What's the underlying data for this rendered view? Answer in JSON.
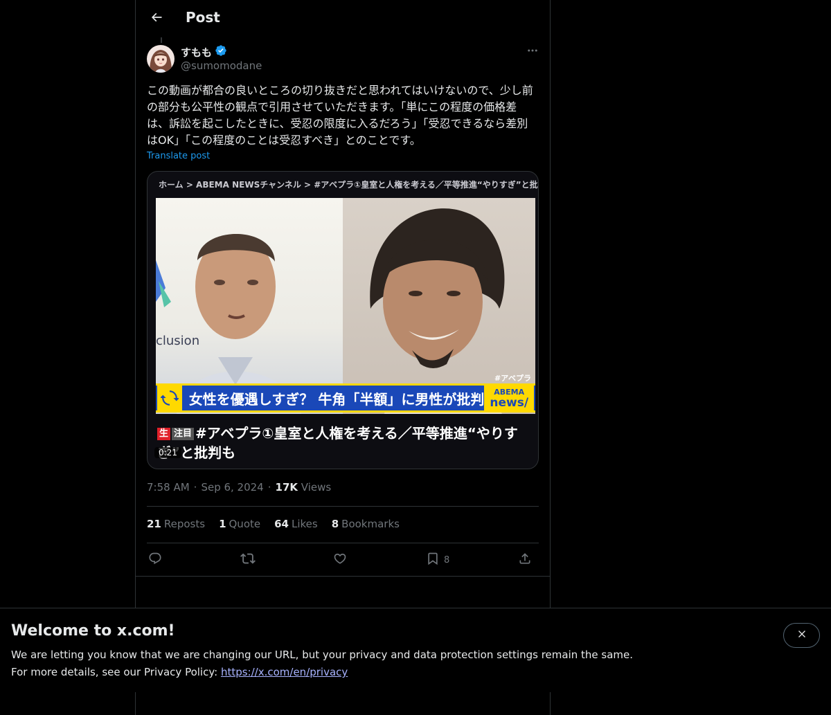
{
  "header": {
    "title": "Post",
    "back_icon": "arrow-left-icon"
  },
  "post": {
    "author": {
      "name": "すもも",
      "handle": "@sumomodane",
      "verified": true,
      "verified_color": "#1d9bf0"
    },
    "text": "この動画が都合の良いところの切り抜きだと思われてはいけないので、少し前の部分も公平性の観点で引用させていただきます。「単にこの程度の価格差は、訴訟を起こしたときに、受忍の限度に入るだろう」「受忍できるなら差別はOK」「この程度のことは受忍すべき」とのことです。",
    "translate_label": "Translate post",
    "media": {
      "breadcrumb": "ホーム > ABEMA NEWSチャンネル > #アベプラ①皇室と人権を考える／平等推進“やりすぎ”と批判も",
      "left_sign_text": "clusion",
      "overlay_hashtag": "#アベプラ",
      "ticker_text": "女性を優遇しすぎ？ 牛角「半額」に男性が批判",
      "brand_line1": "ABEMA",
      "brand_line2": "news/",
      "caption_tag_live": "生",
      "caption_tag_hot": "注目",
      "caption": "#アベプラ①皇室と人権を考える／平等推進“やりすぎ”と批判も",
      "duration": "0:21"
    },
    "time": "7:58 AM",
    "date": "Sep 6, 2024",
    "views_count": "17K",
    "views_label": "Views",
    "stats": {
      "reposts_count": "21",
      "reposts_label": "Reposts",
      "quotes_count": "1",
      "quotes_label": "Quote",
      "likes_count": "64",
      "likes_label": "Likes",
      "bookmarks_count": "8",
      "bookmarks_label": "Bookmarks"
    },
    "actions": {
      "reply_icon": "reply-icon",
      "repost_icon": "repost-icon",
      "like_icon": "heart-icon",
      "bookmark_icon": "bookmark-icon",
      "bookmark_count": "8",
      "share_icon": "share-icon"
    }
  },
  "banner": {
    "title": "Welcome to x.com!",
    "line1": "We are letting you know that we are changing our URL, but your privacy and data protection settings remain the same.",
    "line2_prefix": "For more details, see our Privacy Policy: ",
    "link": "https://x.com/en/privacy",
    "close_icon": "close-icon"
  },
  "colors": {
    "background": "#000000",
    "text_primary": "#e7e9ea",
    "text_secondary": "#71767b",
    "accent": "#1d9bf0",
    "border": "#2f3336"
  }
}
